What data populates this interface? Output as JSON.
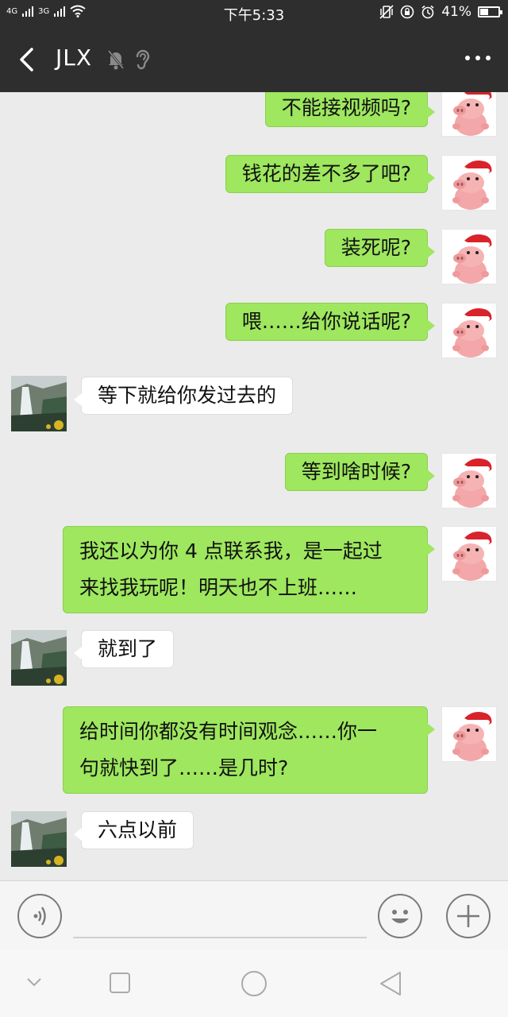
{
  "status_bar": {
    "network_left": "4G",
    "network_right": "3G",
    "time": "下午5:33",
    "battery": "41%",
    "battery_level": 0.41
  },
  "title_bar": {
    "title": "JLX"
  },
  "messages": [
    {
      "side": "out",
      "text": "不能接视频吗?"
    },
    {
      "side": "out",
      "text": "钱花的差不多了吧?"
    },
    {
      "side": "out",
      "text": "装死呢?"
    },
    {
      "side": "out",
      "text": "喂……给你说话呢?"
    },
    {
      "side": "in",
      "text": "等下就给你发过去的"
    },
    {
      "side": "out",
      "text": "等到啥时候?"
    },
    {
      "side": "out",
      "lines": [
        "我还以为你 4 点联系我，是一起过",
        "来找我玩呢！明天也不上班……"
      ]
    },
    {
      "side": "in",
      "text": "就到了"
    },
    {
      "side": "out",
      "lines": [
        "给时间你都没有时间观念……你一",
        "句就快到了……是几时?"
      ]
    },
    {
      "side": "in",
      "text": "六点以前"
    }
  ],
  "colors": {
    "header_bg": "#2e2e2e",
    "out_bubble": "#9ee75e",
    "in_bubble": "#ffffff",
    "chat_bg": "#ebebeb"
  }
}
